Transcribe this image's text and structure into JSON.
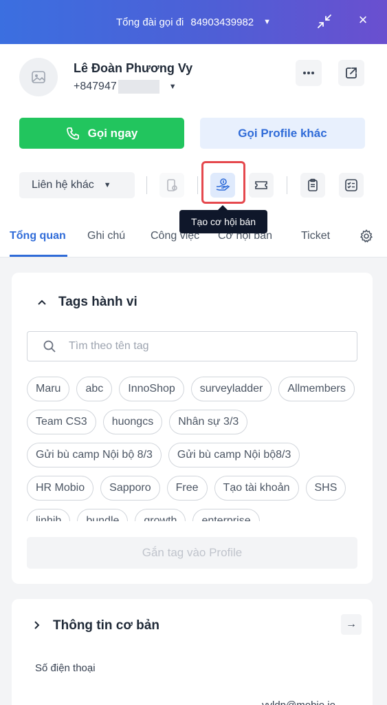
{
  "header": {
    "title": "Tổng đài gọi đi",
    "number": "84903439982",
    "colors": {
      "gradient_start": "#3b6fe0",
      "gradient_end": "#6a4fcf"
    }
  },
  "contact": {
    "name": "Lê Đoàn Phương Vy",
    "phone_prefix": "+847947"
  },
  "actions": {
    "call_now": "Gọi ngay",
    "call_other_profile": "Gọi Profile khác",
    "other_contact": "Liên hệ khác"
  },
  "tooltip": "Tạo cơ hội bán",
  "tabs": [
    {
      "label": "Tổng quan",
      "active": true
    },
    {
      "label": "Ghi chú"
    },
    {
      "label": "Công việc"
    },
    {
      "label": "Cơ hội bán"
    },
    {
      "label": "Ticket"
    }
  ],
  "tags_section": {
    "title": "Tags hành vi",
    "search_placeholder": "Tìm theo tên tag",
    "tags": [
      "Maru",
      "abc",
      "InnoShop",
      "surveyladder",
      "Allmembers",
      "Team CS3",
      "huongcs",
      "Nhân sự 3/3",
      "Gửi bù camp Nội bộ 8/3",
      "Gửi bù camp Nội bộ8/3",
      "HR Mobio",
      "Sapporo",
      "Free",
      "Tạo tài khoản",
      "SHS",
      "linhih",
      "bundle",
      "growth",
      "enterprise"
    ],
    "attach_button": "Gắn tag vào Profile"
  },
  "basic_info": {
    "title": "Thông tin cơ bản",
    "phone_label": "Số điện thoại",
    "email_partial": "vyldp@mobio.io"
  },
  "colors": {
    "primary": "#2f6bd8",
    "green": "#22c55e",
    "highlight": "#e5484d"
  }
}
